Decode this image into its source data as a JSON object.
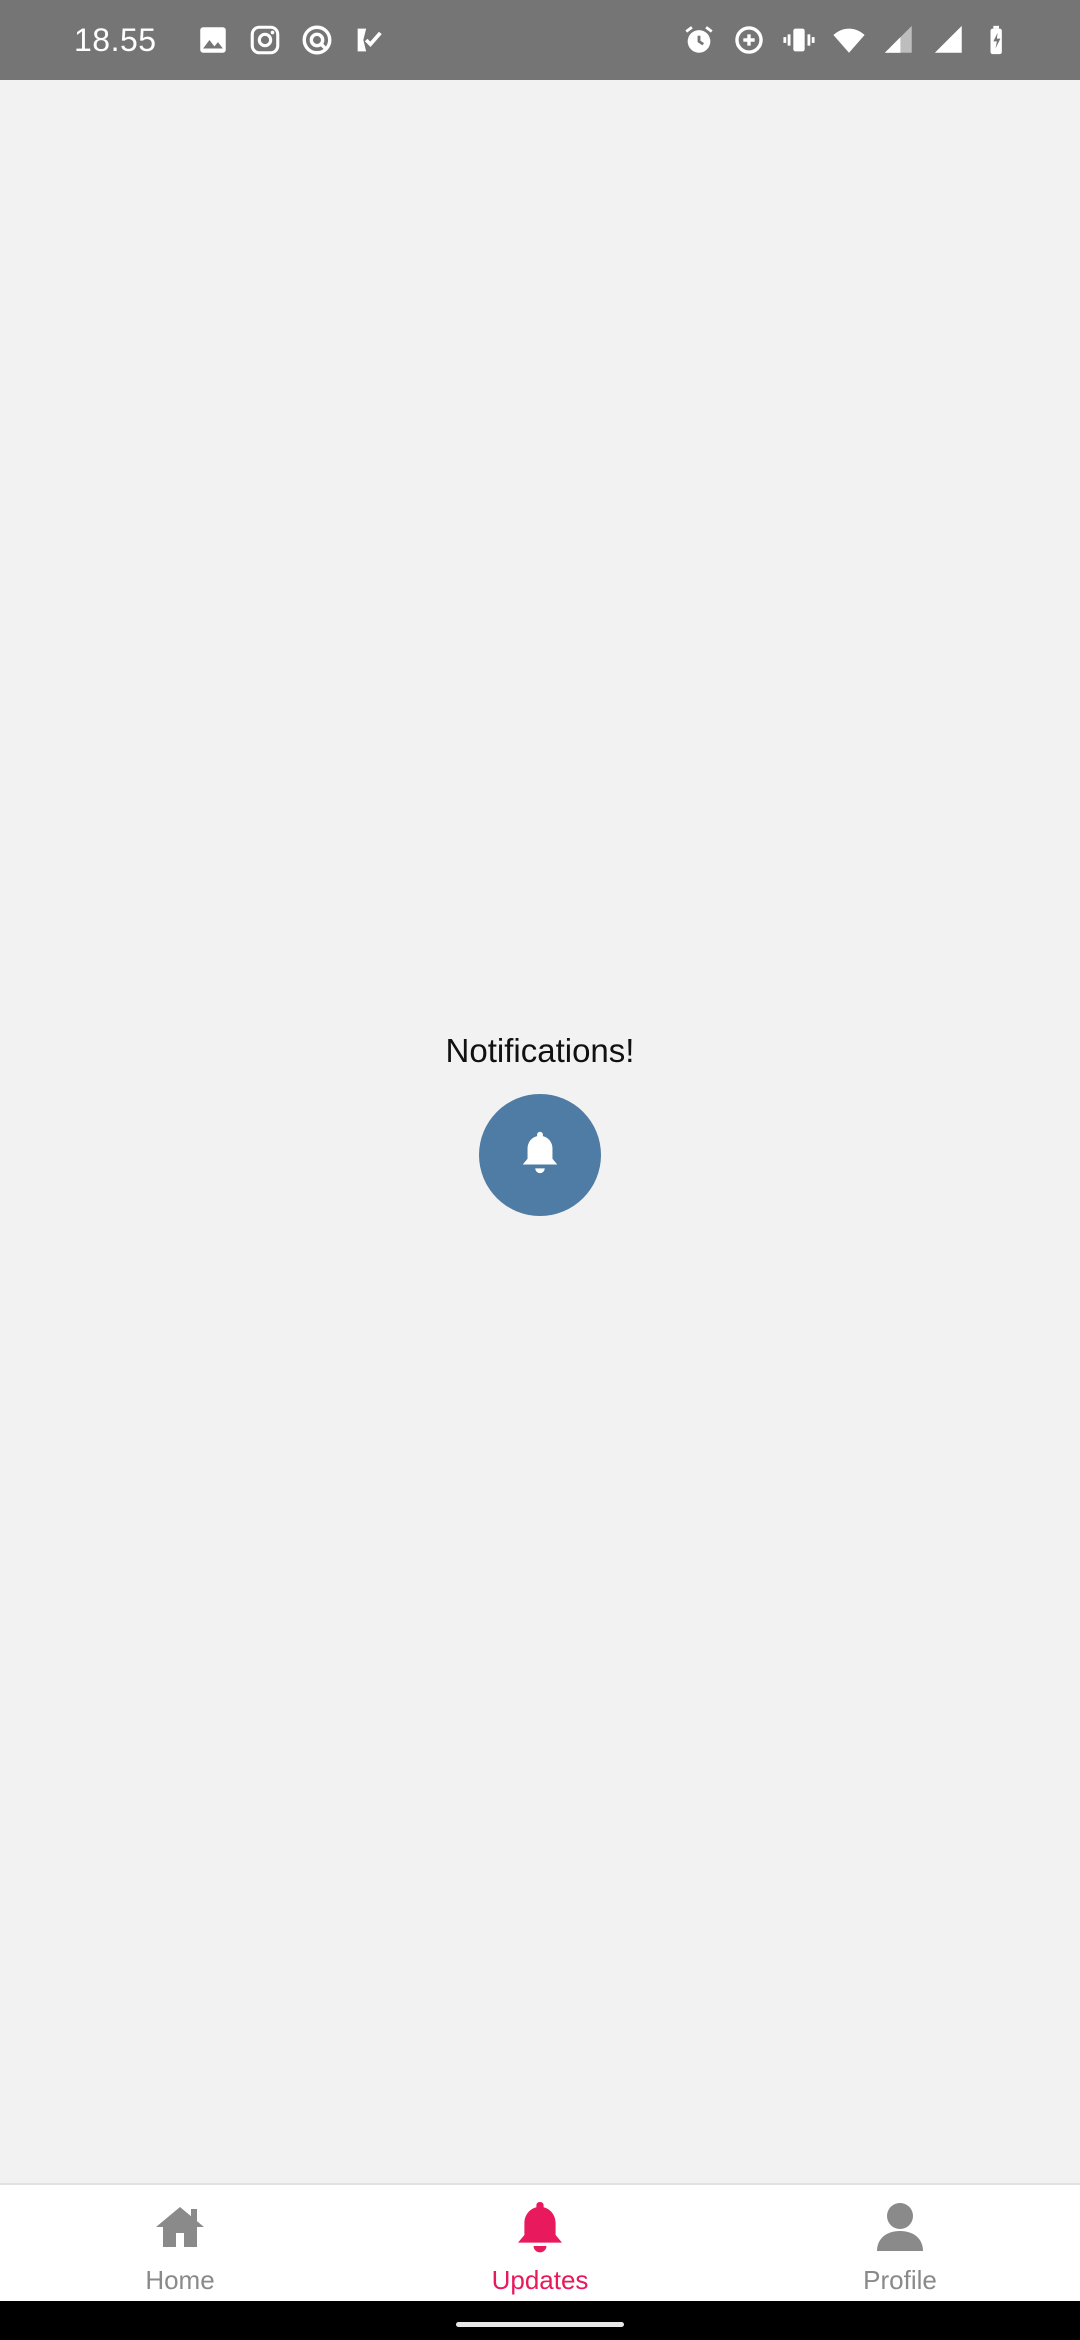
{
  "status_bar": {
    "time": "18.55",
    "left_icons": [
      "image-icon",
      "instagram-icon",
      "opera-icon",
      "check-ticket-icon"
    ],
    "right_icons": [
      "alarm-icon",
      "data-saver-icon",
      "vibrate-icon",
      "wifi-icon",
      "signal-icon",
      "signal-icon",
      "battery-charging-icon"
    ]
  },
  "main": {
    "title": "Notifications!",
    "icon": "bell-icon",
    "icon_bg_color": "#4e7ca5"
  },
  "bottom_nav": {
    "items": [
      {
        "label": "Home",
        "icon": "home-icon",
        "active": false
      },
      {
        "label": "Updates",
        "icon": "bell-icon",
        "active": true
      },
      {
        "label": "Profile",
        "icon": "user-icon",
        "active": false
      }
    ],
    "active_color": "#e8195c",
    "inactive_color": "#8a8a8a"
  }
}
